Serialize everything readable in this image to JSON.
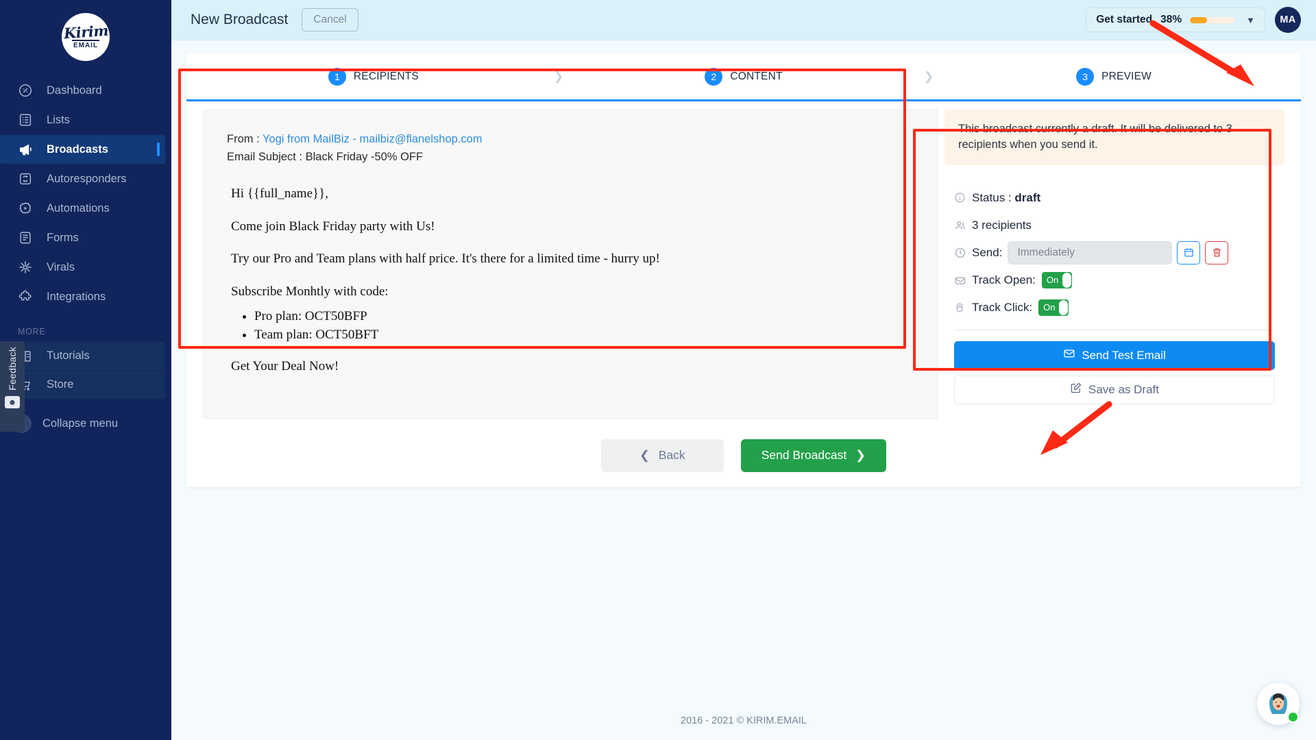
{
  "brand": {
    "logo_script": "Kirim",
    "logo_sub": "EMAIL"
  },
  "sidebar": {
    "items": [
      {
        "label": "Dashboard",
        "icon": "dashboard-icon"
      },
      {
        "label": "Lists",
        "icon": "list-icon"
      },
      {
        "label": "Broadcasts",
        "icon": "megaphone-icon"
      },
      {
        "label": "Autoresponders",
        "icon": "autoresponder-icon"
      },
      {
        "label": "Automations",
        "icon": "automation-icon"
      },
      {
        "label": "Forms",
        "icon": "form-icon"
      },
      {
        "label": "Virals",
        "icon": "viral-icon"
      },
      {
        "label": "Integrations",
        "icon": "puzzle-icon"
      }
    ],
    "more_label": "MORE",
    "more_items": [
      {
        "label": "Tutorials",
        "icon": "tutorial-icon"
      },
      {
        "label": "Store",
        "icon": "cart-icon"
      }
    ],
    "collapse_label": "Collapse menu",
    "feedback_label": "Feedback",
    "active_item": "Broadcasts"
  },
  "topbar": {
    "title": "New Broadcast",
    "cancel_label": "Cancel",
    "get_started_label": "Get started",
    "get_started_percent": "38%",
    "get_started_value": 38,
    "progress_color": "#f5a623",
    "avatar_initials": "MA"
  },
  "stepper": {
    "steps": [
      {
        "num": "1",
        "label": "RECIPIENTS"
      },
      {
        "num": "2",
        "label": "CONTENT"
      },
      {
        "num": "3",
        "label": "PREVIEW"
      }
    ],
    "active_step": "3",
    "accent_color": "#1a8cff"
  },
  "email_preview": {
    "from_label": "From : ",
    "from_value": "Yogi from MailBiz - mailbiz@flanelshop.com",
    "subject_label": "Email Subject : ",
    "subject_value": "Black Friday -50% OFF",
    "greeting": "Hi {{full_name}},",
    "line1": "Come join Black Friday party with Us!",
    "line2": "Try our Pro and Team plans with half price. It's there for a limited time - hurry up!",
    "line3": "Subscribe Monhtly with code:",
    "codes": [
      "Pro plan: OCT50BFP",
      "Team plan: OCT50BFT"
    ],
    "closing": "Get Your Deal Now!"
  },
  "side_panel": {
    "notice": "This broadcast currently a draft. It will be delivered to 3 recipients when you send it.",
    "status_label": "Status : ",
    "status_value": "draft",
    "recipients_text": "3 recipients",
    "send_label": "Send:",
    "send_value": "Immediately",
    "calendar_icon": "calendar-icon",
    "delete_icon": "trash-icon",
    "track_open_label": "Track Open:",
    "track_open_state": "On",
    "track_click_label": "Track Click:",
    "track_click_state": "On",
    "send_test_label": "Send Test Email",
    "save_draft_label": "Save as Draft"
  },
  "actions": {
    "back_label": "Back",
    "send_broadcast_label": "Send Broadcast"
  },
  "footer": {
    "copyright": "2016 - 2021 © KIRIM.EMAIL"
  }
}
